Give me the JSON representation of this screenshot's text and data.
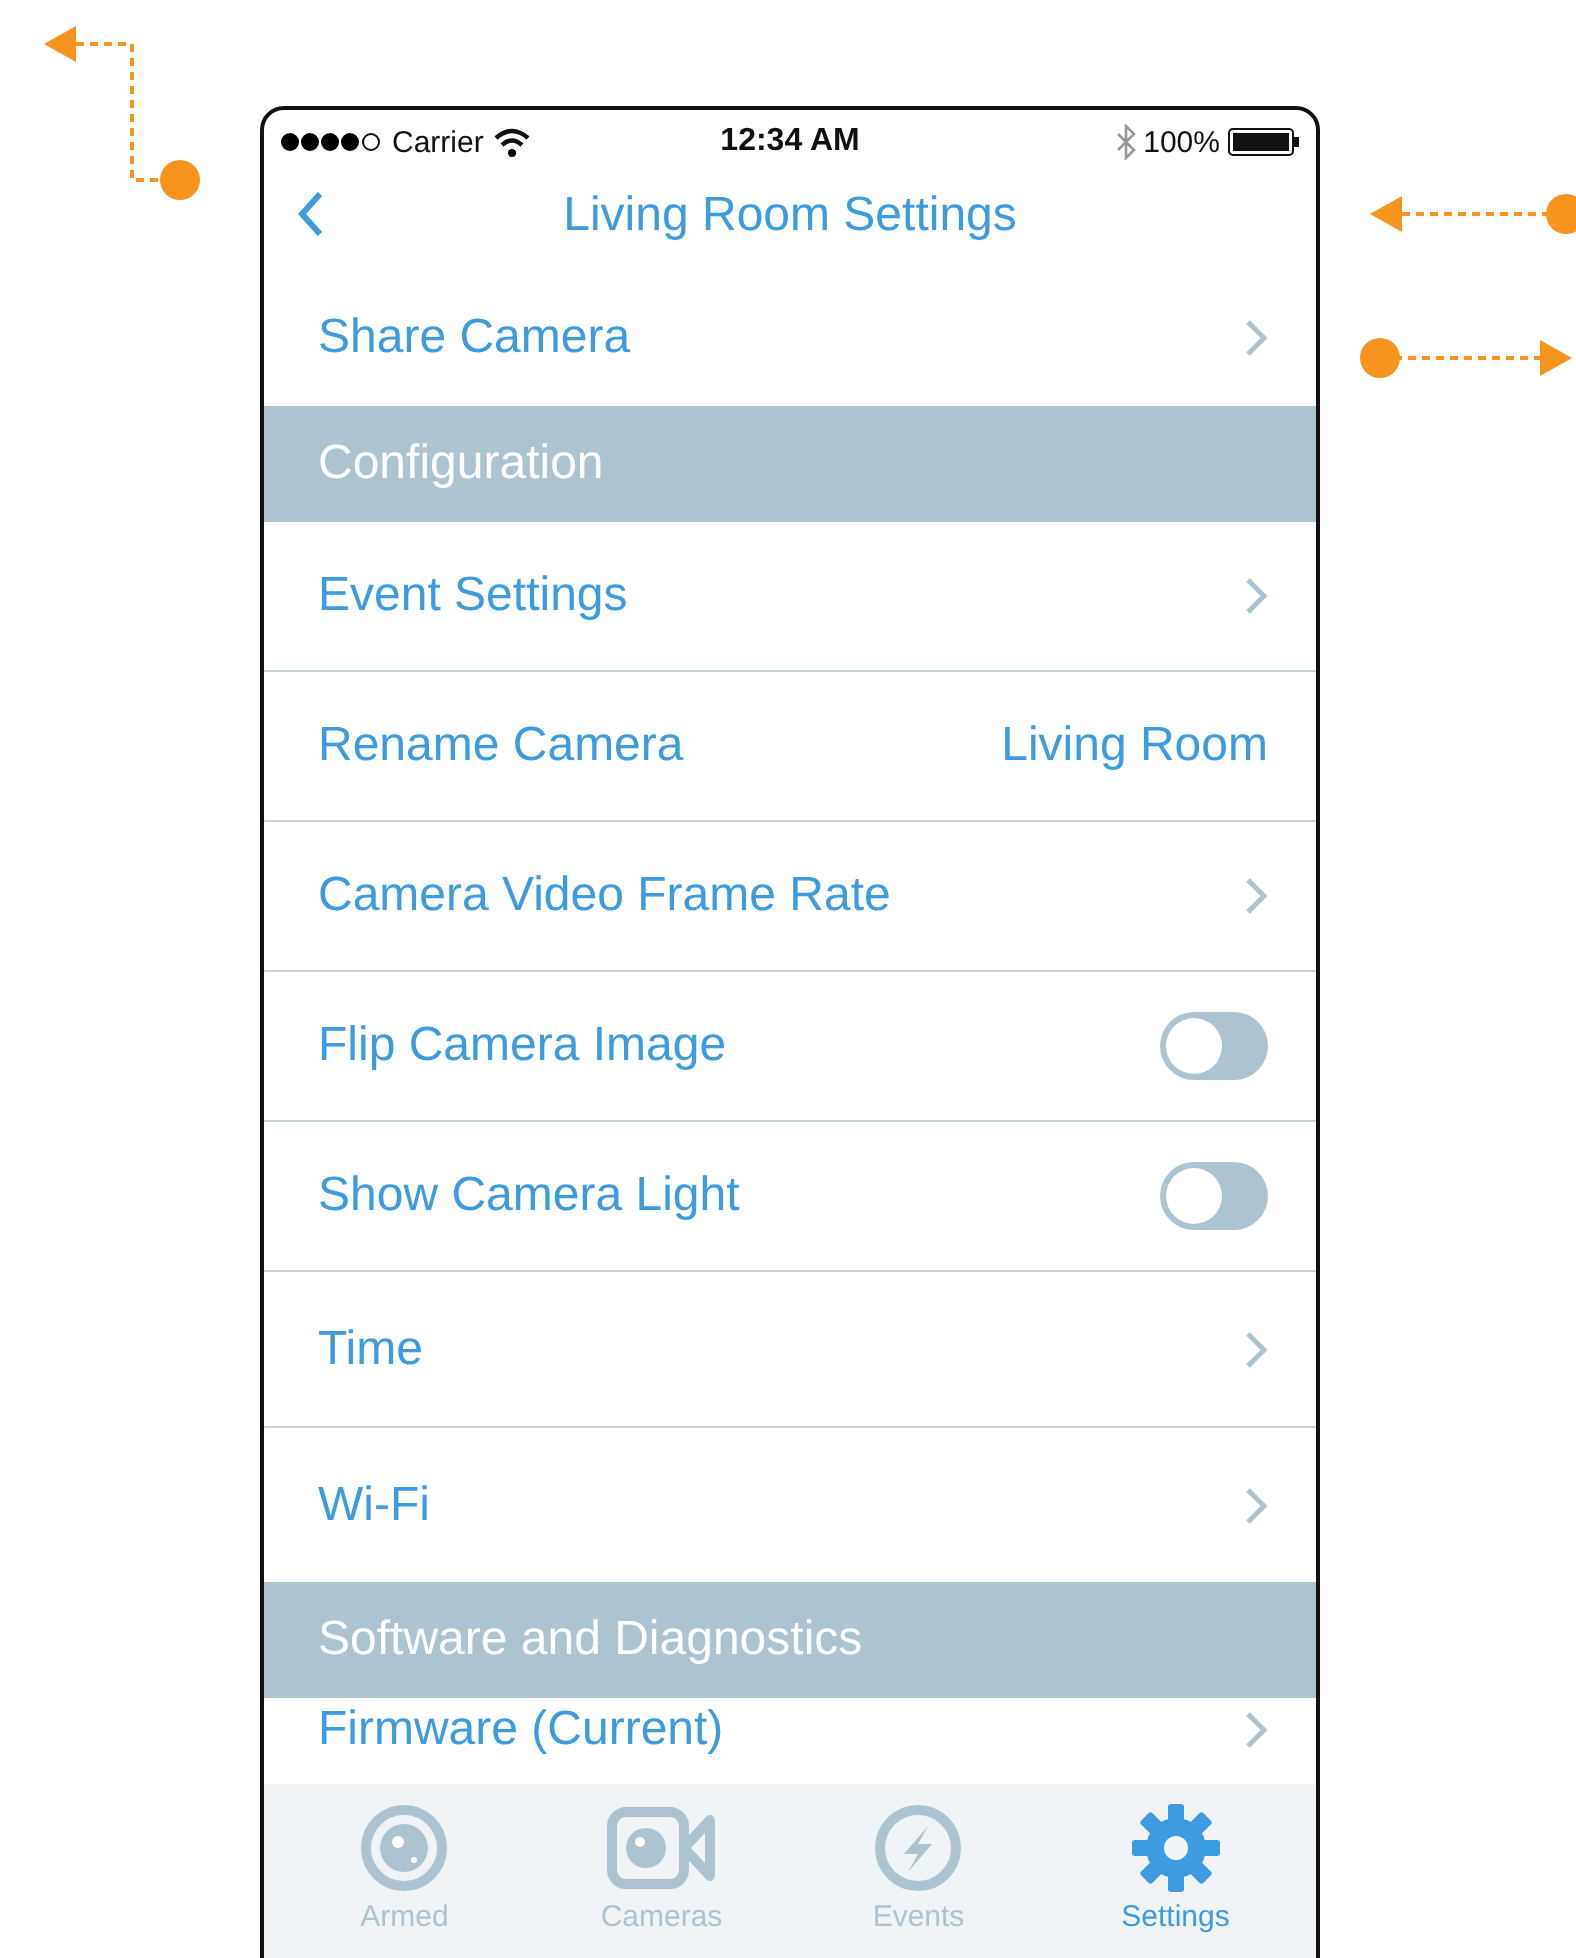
{
  "status_bar": {
    "carrier": "Carrier",
    "time": "12:34 AM",
    "battery": "100%"
  },
  "nav_bar": {
    "title": "Living Room Settings"
  },
  "rows": [
    {
      "kind": "link",
      "label": "Share Camera"
    },
    {
      "kind": "section",
      "label": "Configuration"
    },
    {
      "kind": "link",
      "label": "Event Settings"
    },
    {
      "kind": "value",
      "label": "Rename Camera",
      "value": "Living Room"
    },
    {
      "kind": "link",
      "label": "Camera Video Frame Rate"
    },
    {
      "kind": "toggle",
      "label": "Flip Camera Image",
      "on": false
    },
    {
      "kind": "toggle",
      "label": "Show Camera Light",
      "on": false
    },
    {
      "kind": "link",
      "label": "Time"
    },
    {
      "kind": "link",
      "label": "Wi-Fi"
    },
    {
      "kind": "section",
      "label": "Software and Diagnostics"
    },
    {
      "kind": "link",
      "label": "Firmware (Current)"
    }
  ],
  "tabs": [
    {
      "kind": "armed",
      "label": "Armed",
      "selected": false
    },
    {
      "kind": "cameras",
      "label": "Cameras",
      "selected": false
    },
    {
      "kind": "events",
      "label": "Events",
      "selected": false
    },
    {
      "kind": "settings",
      "label": "Settings",
      "selected": true
    }
  ]
}
